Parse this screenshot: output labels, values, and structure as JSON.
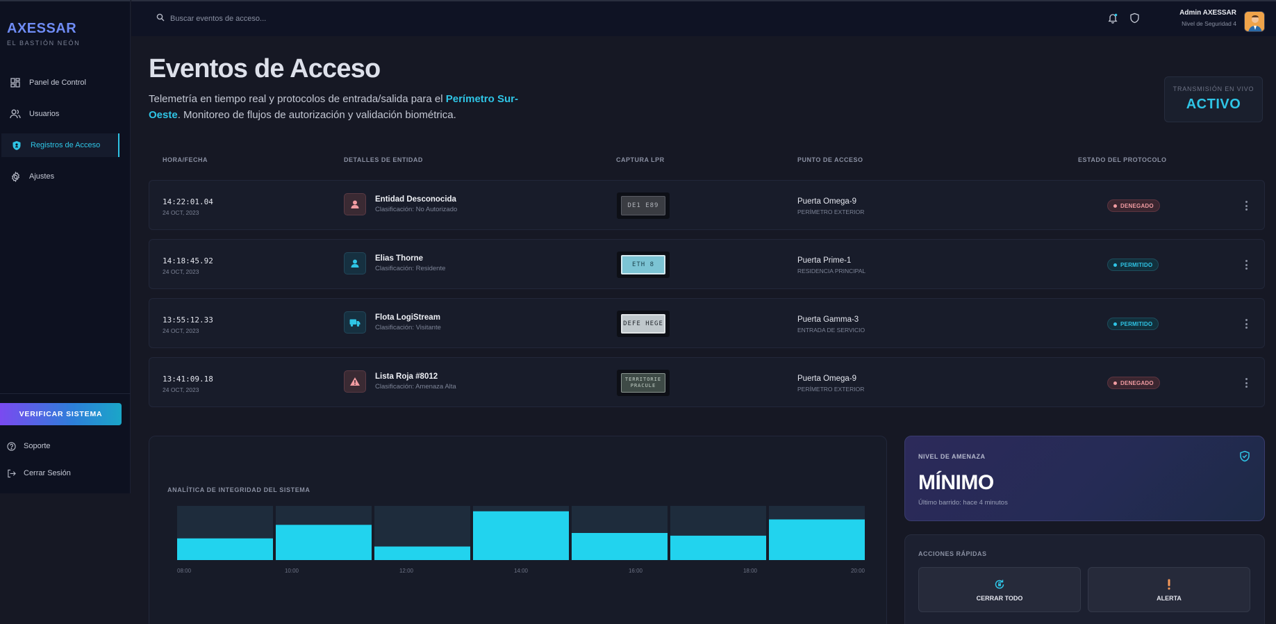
{
  "brand": {
    "name": "AXESSAR",
    "subtitle": "EL BASTIÓN NEÓN"
  },
  "sidebar": {
    "items": [
      {
        "label": "Panel de Control",
        "icon": "dashboard-icon"
      },
      {
        "label": "Usuarios",
        "icon": "users-icon"
      },
      {
        "label": "Registros de Acceso",
        "icon": "shield-icon",
        "active": true
      },
      {
        "label": "Ajustes",
        "icon": "gear-icon"
      }
    ],
    "verify_button": "VERIFICAR SISTEMA",
    "support": "Soporte",
    "logout": "Cerrar Sesión"
  },
  "topbar": {
    "search_placeholder": "Buscar eventos de acceso...",
    "user_name": "Admin AXESSAR",
    "user_level": "Nivel de Seguridad 4"
  },
  "page": {
    "title": "Eventos de Acceso",
    "desc_before": "Telemetría en tiempo real y protocolos de entrada/salida para el ",
    "desc_highlight": "Perímetro Sur-Oeste",
    "desc_after": ". Monitoreo de flujos de autorización y validación biométrica.",
    "live_label": "TRANSMISIÓN EN VIVO",
    "live_value": "ACTIVO"
  },
  "table": {
    "headers": [
      "HORA/FECHA",
      "DETALLES DE ENTIDAD",
      "CAPTURA LPR",
      "PUNTO DE ACCESO",
      "ESTADO DEL PROTOCOLO"
    ],
    "rows": [
      {
        "time": "14:22:01.04",
        "date": "24 OCT, 2023",
        "entity": "Entidad Desconocida",
        "classification": "Clasificación: No Autorizado",
        "icon": "person-icon",
        "plate": "DE1 E89",
        "point": "Puerta Omega-9",
        "zone": "PERÍMETRO EXTERIOR",
        "status": "DENEGADO"
      },
      {
        "time": "14:18:45.92",
        "date": "24 OCT, 2023",
        "entity": "Elias Thorne",
        "classification": "Clasificación: Residente",
        "icon": "person-icon",
        "plate": "ETH 8",
        "point": "Puerta Prime-1",
        "zone": "RESIDENCIA PRINCIPAL",
        "status": "PERMITIDO"
      },
      {
        "time": "13:55:12.33",
        "date": "24 OCT, 2023",
        "entity": "Flota LogiStream",
        "classification": "Clasificación: Visitante",
        "icon": "truck-icon",
        "plate": "DEFE HEGE",
        "point": "Puerta Gamma-3",
        "zone": "ENTRADA DE SERVICIO",
        "status": "PERMITIDO"
      },
      {
        "time": "13:41:09.18",
        "date": "24 OCT, 2023",
        "entity": "Lista Roja #8012",
        "classification": "Clasificación: Amenaza Alta",
        "icon": "warning-icon",
        "plate": "TERRITORIE PRACULE",
        "point": "Puerta Omega-9",
        "zone": "PERÍMETRO EXTERIOR",
        "status": "DENEGADO"
      }
    ]
  },
  "chart_data": {
    "type": "bar",
    "title": "ANALÍTICA DE INTEGRIDAD DEL SISTEMA",
    "categories": [
      "08:00",
      "10:00",
      "12:00",
      "14:00",
      "16:00",
      "18:00",
      "20:00"
    ],
    "values": [
      40,
      65,
      25,
      90,
      50,
      45,
      75
    ],
    "ylim": [
      0,
      100
    ],
    "colors": {
      "bar": "#22d3ee",
      "track": "#1e2c3c"
    }
  },
  "threat": {
    "label": "NIVEL DE AMENAZA",
    "value": "MÍNIMO",
    "sub": "Último barrido: hace 4 minutos"
  },
  "quick": {
    "label": "ACCIONES RÁPIDAS",
    "close_all": "CERRAR TODO",
    "alert": "ALERTA"
  },
  "colors": {
    "accent": "#2fc5e6",
    "denied": "#f29ca2",
    "brand": "#6f8cf5"
  }
}
